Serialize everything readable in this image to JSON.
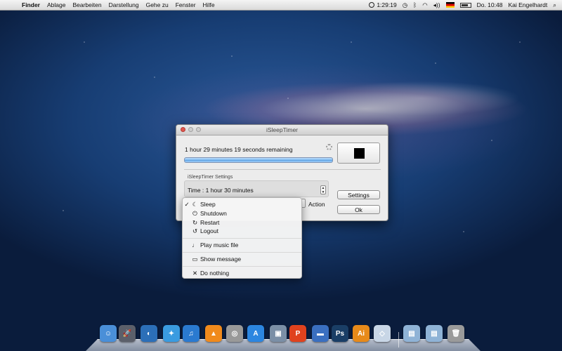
{
  "menubar": {
    "items": [
      "Finder",
      "Ablage",
      "Bearbeiten",
      "Darstellung",
      "Gehe zu",
      "Fenster",
      "Hilfe"
    ],
    "timer": "1:29:19",
    "clock": "Do. 10:48",
    "user": "Kai Engelhardt"
  },
  "window": {
    "title": "iSleepTimer",
    "remaining": "1 hour 29 minutes 19 seconds remaining",
    "progress_fraction": 1.0,
    "settings_group_label": "iSleepTimer Settings",
    "time_label": "Time : 1 hour 30 minutes",
    "action_label": "Action",
    "settings_button": "Settings",
    "ok_button": "Ok"
  },
  "action_menu": {
    "items": [
      {
        "label": "Sleep",
        "icon": "moon-icon",
        "checked": true
      },
      {
        "label": "Shutdown",
        "icon": "power-icon",
        "checked": false
      },
      {
        "label": "Restart",
        "icon": "restart-icon",
        "checked": false
      },
      {
        "label": "Logout",
        "icon": "logout-icon",
        "checked": false
      },
      {
        "label": "Play music file",
        "icon": "music-note-icon",
        "checked": false
      },
      {
        "label": "Show message",
        "icon": "message-icon",
        "checked": false
      },
      {
        "label": "Do nothing",
        "icon": "x-icon",
        "checked": false
      }
    ],
    "check_glyph": "✓"
  },
  "dock": {
    "apps": [
      {
        "name": "finder",
        "glyph": "☺",
        "color": "#4a8fd8"
      },
      {
        "name": "launchpad",
        "glyph": "🚀",
        "color": "#5b5f6a"
      },
      {
        "name": "dashboard",
        "glyph": "◐",
        "color": "#2c6fb8"
      },
      {
        "name": "safari",
        "glyph": "✦",
        "color": "#3a9be0"
      },
      {
        "name": "itunes",
        "glyph": "♫",
        "color": "#2a7ad0"
      },
      {
        "name": "vlc",
        "glyph": "▲",
        "color": "#f08a1c"
      },
      {
        "name": "dvd-player",
        "glyph": "◎",
        "color": "#999999"
      },
      {
        "name": "app-store",
        "glyph": "A",
        "color": "#2c86e0"
      },
      {
        "name": "preview",
        "glyph": "▣",
        "color": "#7b8fa6"
      },
      {
        "name": "presentation",
        "glyph": "P",
        "color": "#e0421e"
      },
      {
        "name": "keynote",
        "glyph": "▬",
        "color": "#3a6fc0"
      },
      {
        "name": "photoshop",
        "glyph": "Ps",
        "color": "#1a3e66"
      },
      {
        "name": "illustrator",
        "glyph": "Ai",
        "color": "#e78a1a"
      },
      {
        "name": "cube-app",
        "glyph": "◇",
        "color": "#c8d6e6"
      },
      {
        "name": "applications-folder",
        "glyph": "▤",
        "color": "#8fb3d6"
      },
      {
        "name": "documents-folder",
        "glyph": "▤",
        "color": "#8fb3d6"
      },
      {
        "name": "trash",
        "glyph": "🗑",
        "color": "#9a9a9a"
      }
    ]
  }
}
